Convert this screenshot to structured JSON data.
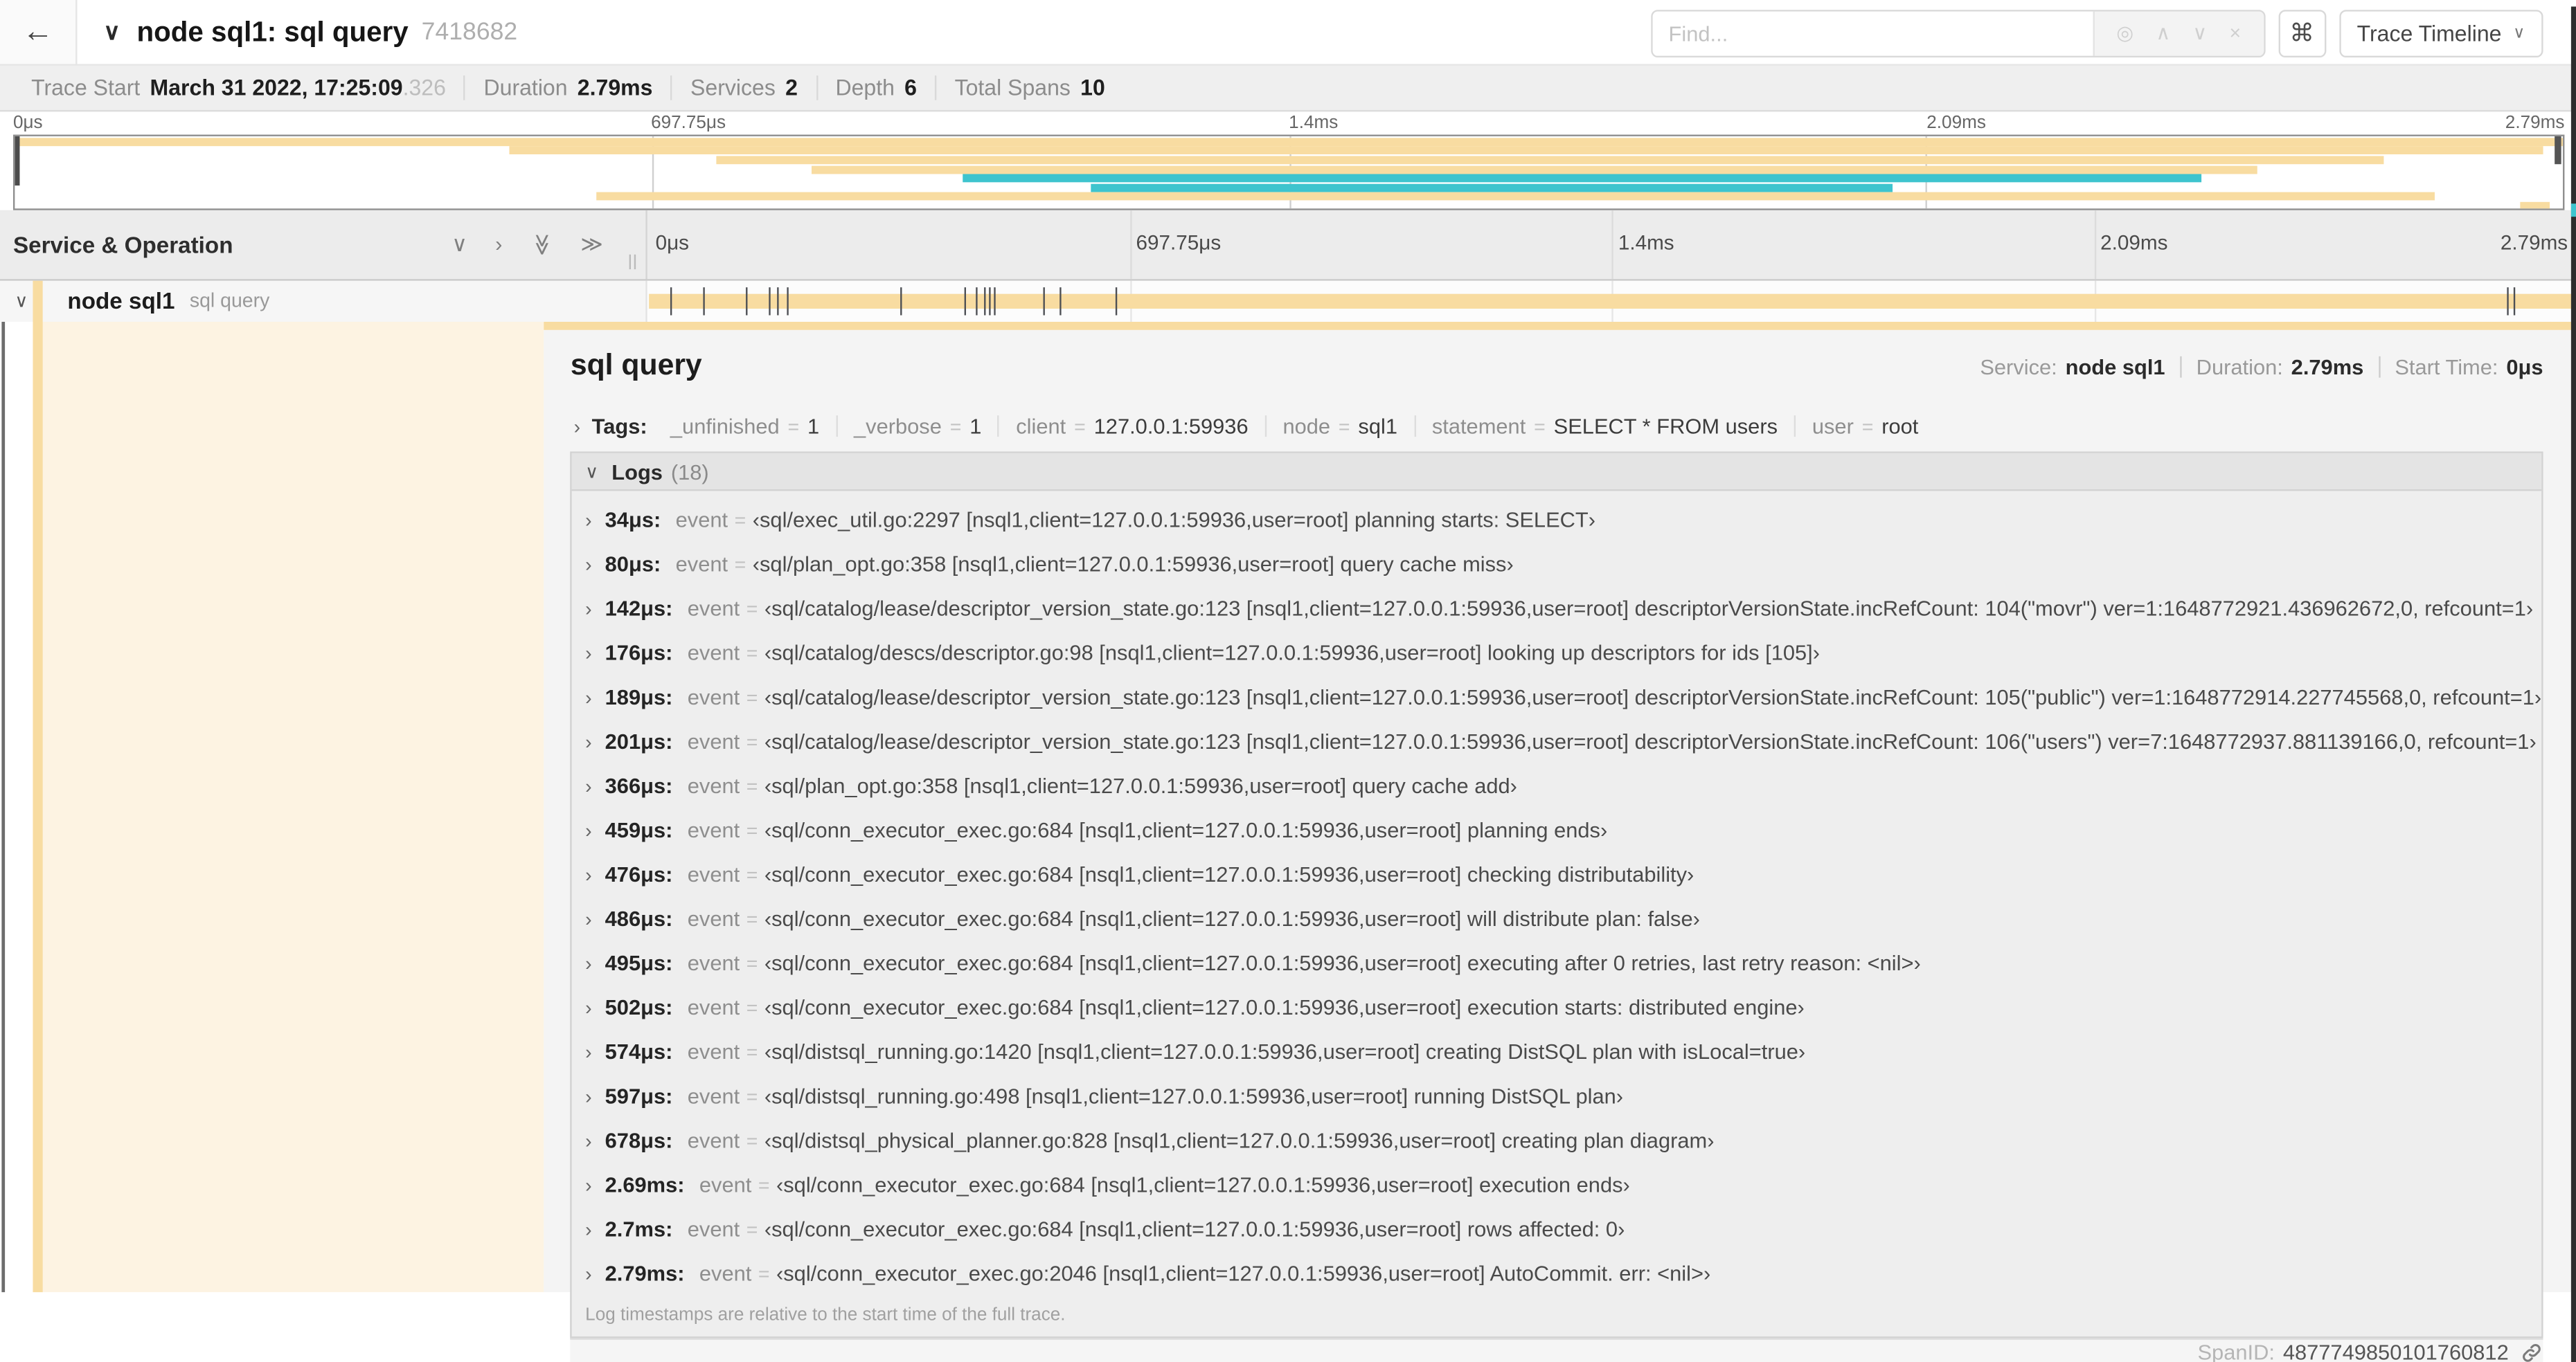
{
  "colors": {
    "span_tan": "#F8DCA1",
    "span_teal": "#3EC4CE",
    "edge_dark": "#2d2d2d"
  },
  "icons": {
    "back": "←",
    "chevron_down": "∨",
    "chevron_right": "›",
    "double_chevron": "≫",
    "locate": "◎",
    "caret_up": "∧",
    "caret_down": "∨",
    "close": "×",
    "command": "⌘"
  },
  "eq_sign": "=",
  "header": {
    "title": "node sql1: sql query",
    "trace_id_short": "7418682",
    "find_placeholder": "Find...",
    "view_button_label": "Trace Timeline"
  },
  "summary": {
    "items": [
      {
        "label": "Trace Start",
        "value": "March 31 2022, 17:25:09",
        "suffix": ".326"
      },
      {
        "label": "Duration",
        "value": "2.79ms",
        "suffix": ""
      },
      {
        "label": "Services",
        "value": "2",
        "suffix": ""
      },
      {
        "label": "Depth",
        "value": "6",
        "suffix": ""
      },
      {
        "label": "Total Spans",
        "value": "10",
        "suffix": ""
      }
    ]
  },
  "ticks": [
    "0μs",
    "697.75μs",
    "1.4ms",
    "2.09ms",
    "2.79ms"
  ],
  "minimap": {
    "spans": [
      {
        "l": 0,
        "w": 100,
        "c": "#F8DCA1"
      },
      {
        "l": 19.4,
        "w": 79.8,
        "c": "#F8DCA1"
      },
      {
        "l": 27.5,
        "w": 65.5,
        "c": "#F8DCA1"
      },
      {
        "l": 31.3,
        "w": 56.7,
        "c": "#F8DCA1"
      },
      {
        "l": 37.2,
        "w": 48.6,
        "c": "#3EC4CE"
      },
      {
        "l": 42.2,
        "w": 31.5,
        "c": "#3EC4CE"
      },
      {
        "l": 22.8,
        "w": 72.2,
        "c": "#F8DCA1"
      },
      {
        "l": 98.3,
        "w": 1.2,
        "c": "#F8DCA1"
      }
    ]
  },
  "timeline": {
    "left_header": "Service & Operation"
  },
  "span_row": {
    "service": "node sql1",
    "operation": "sql query",
    "log_ticks": [
      {
        "p": 1.22
      },
      {
        "p": 2.87
      },
      {
        "p": 5.09
      },
      {
        "p": 6.31
      },
      {
        "p": 6.77
      },
      {
        "p": 7.2
      },
      {
        "p": 13.12
      },
      {
        "p": 16.45
      },
      {
        "p": 17.06
      },
      {
        "p": 17.42
      },
      {
        "p": 17.74
      },
      {
        "p": 17.99
      },
      {
        "p": 20.57
      },
      {
        "p": 21.4
      },
      {
        "p": 24.3
      },
      {
        "p": 96.42
      },
      {
        "p": 96.77
      },
      {
        "p": 99.9
      }
    ]
  },
  "detail": {
    "title": "sql query",
    "meta": [
      {
        "label": "Service:",
        "value": "node sql1"
      },
      {
        "label": "Duration:",
        "value": "2.79ms"
      },
      {
        "label": "Start Time:",
        "value": "0μs"
      }
    ],
    "tags": {
      "label": "Tags:",
      "items": [
        {
          "k": "_unfinished",
          "v": "1"
        },
        {
          "k": "_verbose",
          "v": "1"
        },
        {
          "k": "client",
          "v": "127.0.0.1:59936"
        },
        {
          "k": "node",
          "v": "sql1"
        },
        {
          "k": "statement",
          "v": "SELECT * FROM users"
        },
        {
          "k": "user",
          "v": "root"
        }
      ]
    },
    "logs": {
      "label": "Logs",
      "count": "(18)",
      "entries": [
        {
          "time": "34μs:",
          "key": "event",
          "value": "‹sql/exec_util.go:2297 [nsql1,client=127.0.0.1:59936,user=root] planning starts: SELECT›"
        },
        {
          "time": "80μs:",
          "key": "event",
          "value": "‹sql/plan_opt.go:358 [nsql1,client=127.0.0.1:59936,user=root] query cache miss›"
        },
        {
          "time": "142μs:",
          "key": "event",
          "value": "‹sql/catalog/lease/descriptor_version_state.go:123 [nsql1,client=127.0.0.1:59936,user=root] descriptorVersionState.incRefCount: 104(\"movr\") ver=1:1648772921.436962672,0, refcount=1›"
        },
        {
          "time": "176μs:",
          "key": "event",
          "value": "‹sql/catalog/descs/descriptor.go:98 [nsql1,client=127.0.0.1:59936,user=root] looking up descriptors for ids [105]›"
        },
        {
          "time": "189μs:",
          "key": "event",
          "value": "‹sql/catalog/lease/descriptor_version_state.go:123 [nsql1,client=127.0.0.1:59936,user=root] descriptorVersionState.incRefCount: 105(\"public\") ver=1:1648772914.227745568,0, refcount=1›"
        },
        {
          "time": "201μs:",
          "key": "event",
          "value": "‹sql/catalog/lease/descriptor_version_state.go:123 [nsql1,client=127.0.0.1:59936,user=root] descriptorVersionState.incRefCount: 106(\"users\") ver=7:1648772937.881139166,0, refcount=1›"
        },
        {
          "time": "366μs:",
          "key": "event",
          "value": "‹sql/plan_opt.go:358 [nsql1,client=127.0.0.1:59936,user=root] query cache add›"
        },
        {
          "time": "459μs:",
          "key": "event",
          "value": "‹sql/conn_executor_exec.go:684 [nsql1,client=127.0.0.1:59936,user=root] planning ends›"
        },
        {
          "time": "476μs:",
          "key": "event",
          "value": "‹sql/conn_executor_exec.go:684 [nsql1,client=127.0.0.1:59936,user=root] checking distributability›"
        },
        {
          "time": "486μs:",
          "key": "event",
          "value": "‹sql/conn_executor_exec.go:684 [nsql1,client=127.0.0.1:59936,user=root] will distribute plan: false›"
        },
        {
          "time": "495μs:",
          "key": "event",
          "value": "‹sql/conn_executor_exec.go:684 [nsql1,client=127.0.0.1:59936,user=root] executing after 0 retries, last retry reason: <nil>›"
        },
        {
          "time": "502μs:",
          "key": "event",
          "value": "‹sql/conn_executor_exec.go:684 [nsql1,client=127.0.0.1:59936,user=root] execution starts: distributed engine›"
        },
        {
          "time": "574μs:",
          "key": "event",
          "value": "‹sql/distsql_running.go:1420 [nsql1,client=127.0.0.1:59936,user=root] creating DistSQL plan with isLocal=true›"
        },
        {
          "time": "597μs:",
          "key": "event",
          "value": "‹sql/distsql_running.go:498 [nsql1,client=127.0.0.1:59936,user=root] running DistSQL plan›"
        },
        {
          "time": "678μs:",
          "key": "event",
          "value": "‹sql/distsql_physical_planner.go:828 [nsql1,client=127.0.0.1:59936,user=root] creating plan diagram›"
        },
        {
          "time": "2.69ms:",
          "key": "event",
          "value": "‹sql/conn_executor_exec.go:684 [nsql1,client=127.0.0.1:59936,user=root] execution ends›"
        },
        {
          "time": "2.7ms:",
          "key": "event",
          "value": "‹sql/conn_executor_exec.go:684 [nsql1,client=127.0.0.1:59936,user=root] rows affected: 0›"
        },
        {
          "time": "2.79ms:",
          "key": "event",
          "value": "‹sql/conn_executor_exec.go:2046 [nsql1,client=127.0.0.1:59936,user=root] AutoCommit. err: <nil>›"
        }
      ],
      "footnote": "Log timestamps are relative to the start time of the full trace."
    },
    "footer": {
      "label": "SpanID:",
      "value": "4877749850101760812"
    }
  }
}
